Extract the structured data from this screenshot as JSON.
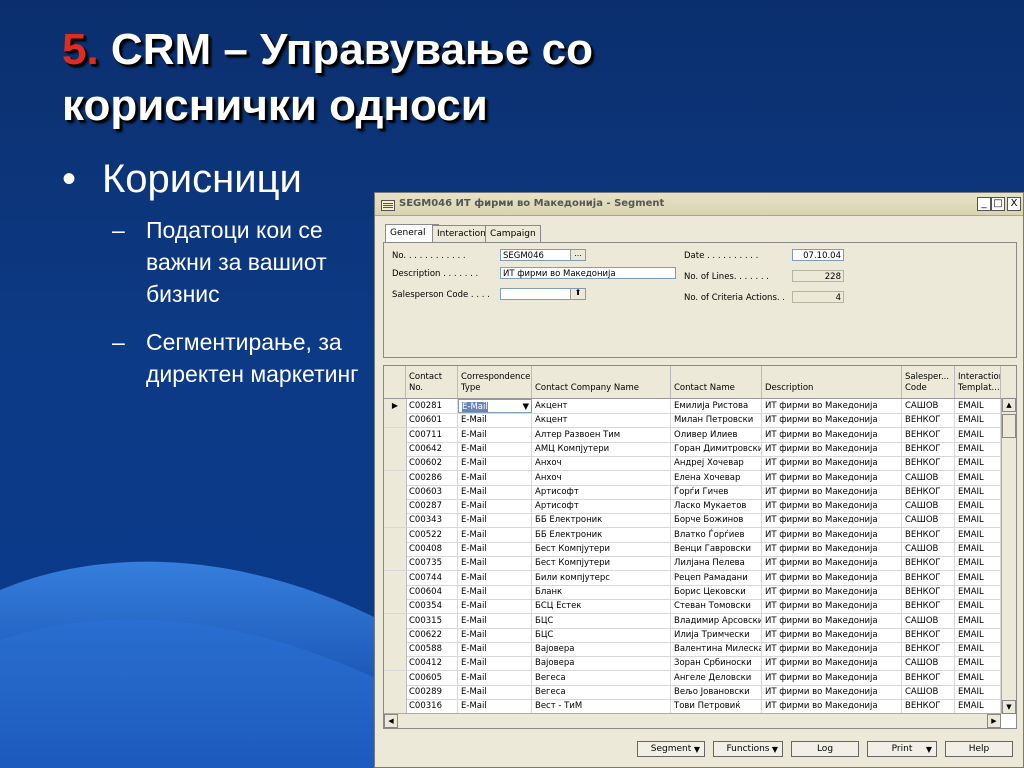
{
  "slide": {
    "title_num": "5.",
    "title_text": " CRM – Управување со кориснички односи",
    "bullet1": "Корисници",
    "sub_bullets": [
      "Податоци кои се важни за вашиот бизнис",
      "Сегментирање, за директен маркетинг"
    ],
    "bullet_dot": "•",
    "dash": "–",
    "colors": {
      "title_number": "#e02b1e",
      "background": "#0d3a85",
      "text": "#ffffff"
    }
  },
  "window": {
    "title": "SEGM046 ИТ фирми во Македонија - Segment",
    "minimize": "_",
    "maximize": "□",
    "close": "X",
    "tabs": [
      "General",
      "Interaction",
      "Campaign"
    ],
    "fields": {
      "no_label": "No. . . . . . . . . . . .",
      "no_value": "SEGM046",
      "description_label": "Description . . . . . . .",
      "description_value": "ИТ фирми во Македонија",
      "salesperson_label": "Salesperson Code . . . .",
      "salesperson_value": "",
      "date_label": "Date . . . . . . . . . .",
      "date_value": "07.10.04",
      "lines_label": "No. of Lines. . . . . . .",
      "lines_value": "228",
      "criteria_label": "No. of Criteria Actions. .",
      "criteria_value": "4",
      "lookup_glyph": "...",
      "arrow_glyph": "⬆"
    },
    "grid": {
      "headers": [
        "Contact No.",
        "Correspondence Type",
        "Contact Company Name",
        "Contact Name",
        "Description",
        "Salesper... Code",
        "Interaction Templat..."
      ],
      "rows": [
        [
          "C00281",
          "E-Mail",
          "Акцент",
          "Емилија Ристова",
          "ИТ фирми во Македонија",
          "САШОВ",
          "EMAIL"
        ],
        [
          "C00601",
          "E-Mail",
          "Акцент",
          "Милан Петровски",
          "ИТ фирми во Македонија",
          "ВЕНКОГ",
          "EMAIL"
        ],
        [
          "C00711",
          "E-Mail",
          "Алтер Развоен Тим",
          "Оливер Илиев",
          "ИТ фирми во Македонија",
          "ВЕНКОГ",
          "EMAIL"
        ],
        [
          "C00642",
          "E-Mail",
          "АМЦ Компјутери",
          "Горан Димитровски",
          "ИТ фирми во Македонија",
          "ВЕНКОГ",
          "EMAIL"
        ],
        [
          "C00602",
          "E-Mail",
          "Анхоч",
          "Андреј Хочевар",
          "ИТ фирми во Македонија",
          "ВЕНКОГ",
          "EMAIL"
        ],
        [
          "C00286",
          "E-Mail",
          "Анхоч",
          "Елена Хочевар",
          "ИТ фирми во Македонија",
          "САШОВ",
          "EMAIL"
        ],
        [
          "C00603",
          "E-Mail",
          "Артисофт",
          "Ѓорѓи Гичев",
          "ИТ фирми во Македонија",
          "ВЕНКОГ",
          "EMAIL"
        ],
        [
          "C00287",
          "E-Mail",
          "Артисофт",
          "Ласко Мукаетов",
          "ИТ фирми во Македонија",
          "САШОВ",
          "EMAIL"
        ],
        [
          "C00343",
          "E-Mail",
          "ББ Електроник",
          "Борче Божинов",
          "ИТ фирми во Македонија",
          "САШОВ",
          "EMAIL"
        ],
        [
          "C00522",
          "E-Mail",
          "ББ Електроник",
          "Влатко Ѓорѓиев",
          "ИТ фирми во Македонија",
          "ВЕНКОГ",
          "EMAIL"
        ],
        [
          "C00408",
          "E-Mail",
          "Бест Компјутери",
          "Венци Гавровски",
          "ИТ фирми во Македонија",
          "САШОВ",
          "EMAIL"
        ],
        [
          "C00735",
          "E-Mail",
          "Бест Компјутери",
          "Лилјана Пелева",
          "ИТ фирми во Македонија",
          "ВЕНКОГ",
          "EMAIL"
        ],
        [
          "C00744",
          "E-Mail",
          "Били компјутерс",
          "Рецеп Рамадани",
          "ИТ фирми во Македонија",
          "ВЕНКОГ",
          "EMAIL"
        ],
        [
          "C00604",
          "E-Mail",
          "Бланк",
          "Борис Цековски",
          "ИТ фирми во Македонија",
          "ВЕНКОГ",
          "EMAIL"
        ],
        [
          "C00354",
          "E-Mail",
          "БСЦ Естек",
          "Стеван Томовски",
          "ИТ фирми во Македонија",
          "ВЕНКОГ",
          "EMAIL"
        ],
        [
          "C00315",
          "E-Mail",
          "БЦС",
          "Владимир Арсовски",
          "ИТ фирми во Македонија",
          "САШОВ",
          "EMAIL"
        ],
        [
          "C00622",
          "E-Mail",
          "БЦС",
          "Илија Тримчески",
          "ИТ фирми во Македонија",
          "ВЕНКОГ",
          "EMAIL"
        ],
        [
          "C00588",
          "E-Mail",
          "Вајовера",
          "Валентина Милеска",
          "ИТ фирми во Македонија",
          "ВЕНКОГ",
          "EMAIL"
        ],
        [
          "C00412",
          "E-Mail",
          "Вајовера",
          "Зоран Србиноски",
          "ИТ фирми во Македонија",
          "САШОВ",
          "EMAIL"
        ],
        [
          "C00605",
          "E-Mail",
          "Вегеса",
          "Ангеле Деловски",
          "ИТ фирми во Македонија",
          "ВЕНКОГ",
          "EMAIL"
        ],
        [
          "C00289",
          "E-Mail",
          "Вегеса",
          "Вељо Јовановски",
          "ИТ фирми во Македонија",
          "САШОВ",
          "EMAIL"
        ],
        [
          "C00316",
          "E-Mail",
          "Вест - ТиМ",
          "Тови Петровиќ",
          "ИТ фирми во Македонија",
          "ВЕНКОГ",
          "EMAIL"
        ]
      ],
      "selected_glyph": "▶",
      "dropdown_glyph": "▼",
      "scroll_up": "▲",
      "scroll_down": "▼",
      "scroll_left": "◀",
      "scroll_right": "▶"
    },
    "buttons": {
      "segment": "Segment",
      "functions": "Functions",
      "log": "Log",
      "print": "Print",
      "help": "Help",
      "dd": "▼"
    }
  }
}
